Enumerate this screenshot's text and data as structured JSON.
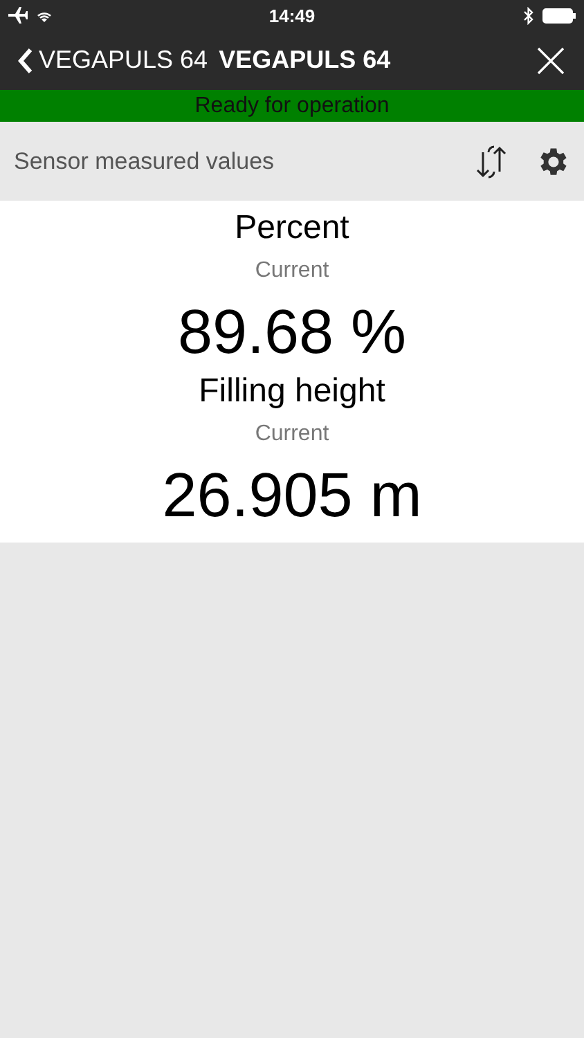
{
  "status_bar": {
    "time": "14:49"
  },
  "nav": {
    "back_label": "VEGAPULS 64",
    "title": "VEGAPULS 64"
  },
  "status_banner": {
    "text": "Ready for operation",
    "color": "#008000"
  },
  "section": {
    "title": "Sensor measured values"
  },
  "measurements": [
    {
      "name": "Percent",
      "label": "Current",
      "value": "89.68 %"
    },
    {
      "name": "Filling height",
      "label": "Current",
      "value": "26.905 m"
    }
  ]
}
